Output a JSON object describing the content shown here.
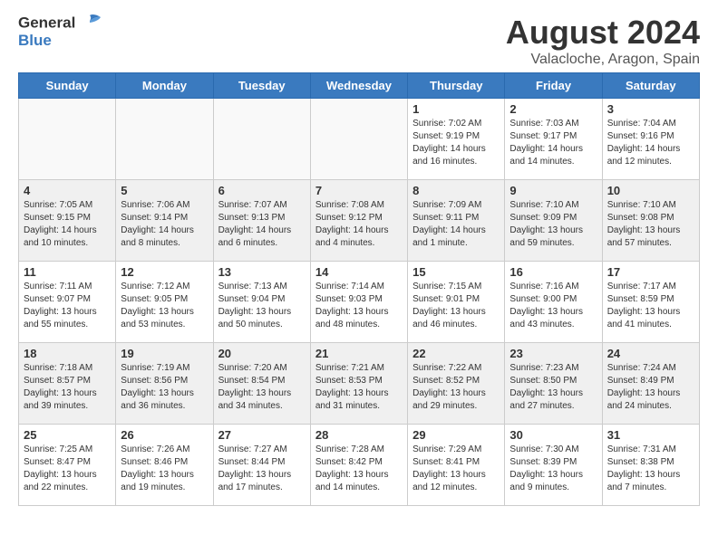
{
  "header": {
    "logo_line1": "General",
    "logo_line2": "Blue",
    "month_title": "August 2024",
    "location": "Valacloche, Aragon, Spain"
  },
  "weekdays": [
    "Sunday",
    "Monday",
    "Tuesday",
    "Wednesday",
    "Thursday",
    "Friday",
    "Saturday"
  ],
  "weeks": [
    [
      {
        "day": "",
        "info": ""
      },
      {
        "day": "",
        "info": ""
      },
      {
        "day": "",
        "info": ""
      },
      {
        "day": "",
        "info": ""
      },
      {
        "day": "1",
        "info": "Sunrise: 7:02 AM\nSunset: 9:19 PM\nDaylight: 14 hours\nand 16 minutes."
      },
      {
        "day": "2",
        "info": "Sunrise: 7:03 AM\nSunset: 9:17 PM\nDaylight: 14 hours\nand 14 minutes."
      },
      {
        "day": "3",
        "info": "Sunrise: 7:04 AM\nSunset: 9:16 PM\nDaylight: 14 hours\nand 12 minutes."
      }
    ],
    [
      {
        "day": "4",
        "info": "Sunrise: 7:05 AM\nSunset: 9:15 PM\nDaylight: 14 hours\nand 10 minutes."
      },
      {
        "day": "5",
        "info": "Sunrise: 7:06 AM\nSunset: 9:14 PM\nDaylight: 14 hours\nand 8 minutes."
      },
      {
        "day": "6",
        "info": "Sunrise: 7:07 AM\nSunset: 9:13 PM\nDaylight: 14 hours\nand 6 minutes."
      },
      {
        "day": "7",
        "info": "Sunrise: 7:08 AM\nSunset: 9:12 PM\nDaylight: 14 hours\nand 4 minutes."
      },
      {
        "day": "8",
        "info": "Sunrise: 7:09 AM\nSunset: 9:11 PM\nDaylight: 14 hours\nand 1 minute."
      },
      {
        "day": "9",
        "info": "Sunrise: 7:10 AM\nSunset: 9:09 PM\nDaylight: 13 hours\nand 59 minutes."
      },
      {
        "day": "10",
        "info": "Sunrise: 7:10 AM\nSunset: 9:08 PM\nDaylight: 13 hours\nand 57 minutes."
      }
    ],
    [
      {
        "day": "11",
        "info": "Sunrise: 7:11 AM\nSunset: 9:07 PM\nDaylight: 13 hours\nand 55 minutes."
      },
      {
        "day": "12",
        "info": "Sunrise: 7:12 AM\nSunset: 9:05 PM\nDaylight: 13 hours\nand 53 minutes."
      },
      {
        "day": "13",
        "info": "Sunrise: 7:13 AM\nSunset: 9:04 PM\nDaylight: 13 hours\nand 50 minutes."
      },
      {
        "day": "14",
        "info": "Sunrise: 7:14 AM\nSunset: 9:03 PM\nDaylight: 13 hours\nand 48 minutes."
      },
      {
        "day": "15",
        "info": "Sunrise: 7:15 AM\nSunset: 9:01 PM\nDaylight: 13 hours\nand 46 minutes."
      },
      {
        "day": "16",
        "info": "Sunrise: 7:16 AM\nSunset: 9:00 PM\nDaylight: 13 hours\nand 43 minutes."
      },
      {
        "day": "17",
        "info": "Sunrise: 7:17 AM\nSunset: 8:59 PM\nDaylight: 13 hours\nand 41 minutes."
      }
    ],
    [
      {
        "day": "18",
        "info": "Sunrise: 7:18 AM\nSunset: 8:57 PM\nDaylight: 13 hours\nand 39 minutes."
      },
      {
        "day": "19",
        "info": "Sunrise: 7:19 AM\nSunset: 8:56 PM\nDaylight: 13 hours\nand 36 minutes."
      },
      {
        "day": "20",
        "info": "Sunrise: 7:20 AM\nSunset: 8:54 PM\nDaylight: 13 hours\nand 34 minutes."
      },
      {
        "day": "21",
        "info": "Sunrise: 7:21 AM\nSunset: 8:53 PM\nDaylight: 13 hours\nand 31 minutes."
      },
      {
        "day": "22",
        "info": "Sunrise: 7:22 AM\nSunset: 8:52 PM\nDaylight: 13 hours\nand 29 minutes."
      },
      {
        "day": "23",
        "info": "Sunrise: 7:23 AM\nSunset: 8:50 PM\nDaylight: 13 hours\nand 27 minutes."
      },
      {
        "day": "24",
        "info": "Sunrise: 7:24 AM\nSunset: 8:49 PM\nDaylight: 13 hours\nand 24 minutes."
      }
    ],
    [
      {
        "day": "25",
        "info": "Sunrise: 7:25 AM\nSunset: 8:47 PM\nDaylight: 13 hours\nand 22 minutes."
      },
      {
        "day": "26",
        "info": "Sunrise: 7:26 AM\nSunset: 8:46 PM\nDaylight: 13 hours\nand 19 minutes."
      },
      {
        "day": "27",
        "info": "Sunrise: 7:27 AM\nSunset: 8:44 PM\nDaylight: 13 hours\nand 17 minutes."
      },
      {
        "day": "28",
        "info": "Sunrise: 7:28 AM\nSunset: 8:42 PM\nDaylight: 13 hours\nand 14 minutes."
      },
      {
        "day": "29",
        "info": "Sunrise: 7:29 AM\nSunset: 8:41 PM\nDaylight: 13 hours\nand 12 minutes."
      },
      {
        "day": "30",
        "info": "Sunrise: 7:30 AM\nSunset: 8:39 PM\nDaylight: 13 hours\nand 9 minutes."
      },
      {
        "day": "31",
        "info": "Sunrise: 7:31 AM\nSunset: 8:38 PM\nDaylight: 13 hours\nand 7 minutes."
      }
    ]
  ]
}
